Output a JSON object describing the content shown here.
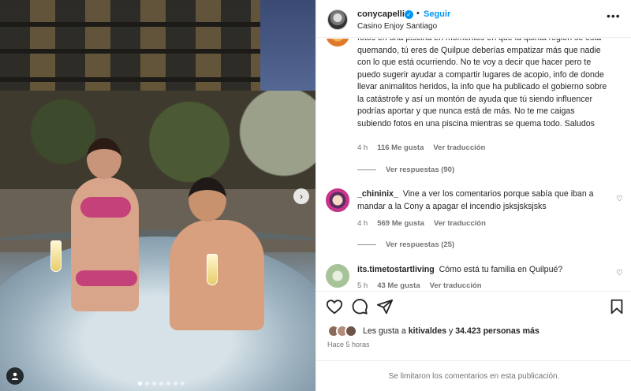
{
  "post": {
    "username": "conycapelli",
    "verified_badge": "✓",
    "separator": "•",
    "follow_label": "Seguir",
    "location": "Casino Enjoy Santiago",
    "more_icon": "more-horizontal-icon"
  },
  "comments": [
    {
      "user": "",
      "text": "fotos en una piscina en momentos en que la quinta region se está quemando, tú eres de Quilpue deberías empatizar más que nadie con lo que está ocurriendo. No te voy a decir que hacer pero te puedo sugerir ayudar a compartir lugares de acopio, info de donde llevar animalitos heridos, la info que ha publicado el gobierno sobre la catástrofe y así un montón de ayuda que tú siendo influencer podrías aportar y que nunca está de más. No te me caigas subiendo fotos en una piscina mientras se quema todo. Saludos",
      "time": "4 h",
      "likes": "116 Me gusta",
      "translate": "Ver traducción",
      "replies": "Ver respuestas (90)"
    },
    {
      "user": "_chininix_",
      "text": "Vine a ver los comentarios porque sabía que iban a mandar a la Cony a apagar el incendio jsksjsksjsks",
      "time": "4 h",
      "likes": "569 Me gusta",
      "translate": "Ver traducción",
      "replies": "Ver respuestas (25)"
    },
    {
      "user": "its.timetostartliving",
      "text": "Cómo está tu familia en Quilpué?",
      "time": "5 h",
      "likes": "43 Me gusta",
      "translate": "Ver traducción"
    }
  ],
  "actions": {
    "like_icon": "heart-icon",
    "comment_icon": "comment-icon",
    "share_icon": "send-icon",
    "save_icon": "bookmark-icon"
  },
  "likes": {
    "prefix": "Les gusta a",
    "user": "kitivaldes",
    "middle": "y",
    "count": "34.423 personas más"
  },
  "time_ago": "Hace 5 horas",
  "footer": "Se limitaron los comentarios en esta publicación.",
  "carousel": {
    "active_index": 0,
    "count": 7
  },
  "colors": {
    "accent": "#0095f6",
    "text": "#262626",
    "muted": "#737373"
  }
}
